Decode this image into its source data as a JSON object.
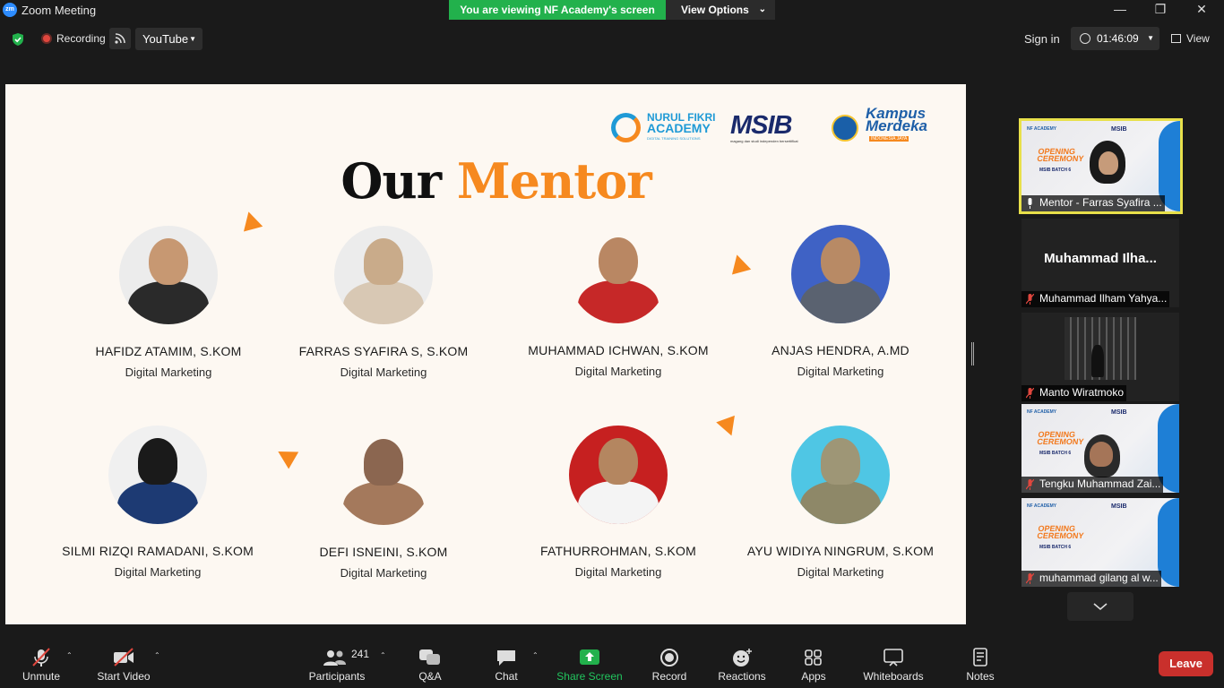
{
  "window": {
    "title": "Zoom Meeting",
    "logo_text": "zm"
  },
  "share": {
    "banner": "You are viewing NF Academy's screen",
    "view_options": "View Options"
  },
  "meeting_bar": {
    "recording": "Recording",
    "stream_target": "YouTube",
    "sign_in": "Sign in",
    "timer": "01:46:09",
    "view": "View"
  },
  "slide": {
    "logos": {
      "nf_line1": "NURUL FIKRI",
      "nf_line2": "ACADEMY",
      "nf_sub": "DIGITAL TRAINING SOLUTIONS",
      "msib": "MSIB",
      "msib_sub": "magang dan studi independen bersertifikat",
      "km_line1": "Kampus",
      "km_line2": "Merdeka",
      "km_sub": "INDONESIA JAYA"
    },
    "title_part1": "Our",
    "title_part2": "Mentor",
    "mentors": [
      {
        "name": "HAFIDZ ATAMIM, S.KOM",
        "role": "Digital Marketing"
      },
      {
        "name": "FARRAS SYAFIRA S, S.KOM",
        "role": "Digital Marketing"
      },
      {
        "name": "MUHAMMAD ICHWAN, S.KOM",
        "role": "Digital Marketing"
      },
      {
        "name": "ANJAS HENDRA, A.MD",
        "role": "Digital Marketing"
      },
      {
        "name": "SILMI RIZQI RAMADANI, S.KOM",
        "role": "Digital Marketing"
      },
      {
        "name": "DEFI ISNEINI, S.KOM",
        "role": "Digital Marketing"
      },
      {
        "name": "FATHURROHMAN, S.KOM",
        "role": "Digital Marketing"
      },
      {
        "name": "AYU WIDIYA NINGRUM, S.KOM",
        "role": "Digital Marketing"
      }
    ]
  },
  "participants_panel": [
    {
      "name": "Mentor - Farras Syafira ...",
      "muted": false,
      "video": true,
      "mini_nf": "NF ACADEMY",
      "mini_title": "OPENING CEREMONY",
      "mini_batch": "MSIB BATCH 6",
      "mini_msib": "MSIB"
    },
    {
      "name": "Muhammad Ilham Yahya...",
      "display": "Muhammad  Ilha...",
      "muted": true,
      "video": false
    },
    {
      "name": "Manto Wiratmoko",
      "muted": true,
      "video": true
    },
    {
      "name": "Tengku Muhammad Zai...",
      "muted": true,
      "video": true,
      "mini_nf": "NF ACADEMY",
      "mini_title": "OPENING CEREMONY",
      "mini_batch": "MSIB BATCH 6",
      "mini_msib": "MSIB"
    },
    {
      "name": "muhammad gilang al w...",
      "muted": true,
      "video": true,
      "mini_nf": "NF ACADEMY",
      "mini_title": "OPENING CEREMONY",
      "mini_batch": "MSIB BATCH 6",
      "mini_msib": "MSIB"
    }
  ],
  "controls": {
    "unmute": "Unmute",
    "start_video": "Start Video",
    "participants": "Participants",
    "participants_count": "241",
    "qa": "Q&A",
    "chat": "Chat",
    "share_screen": "Share Screen",
    "record": "Record",
    "reactions": "Reactions",
    "apps": "Apps",
    "whiteboards": "Whiteboards",
    "notes": "Notes",
    "leave": "Leave"
  },
  "colors": {
    "accent_orange": "#f6891f",
    "share_green": "#22b14c",
    "leave_red": "#c9302c",
    "active_speaker": "#e8e04a"
  }
}
